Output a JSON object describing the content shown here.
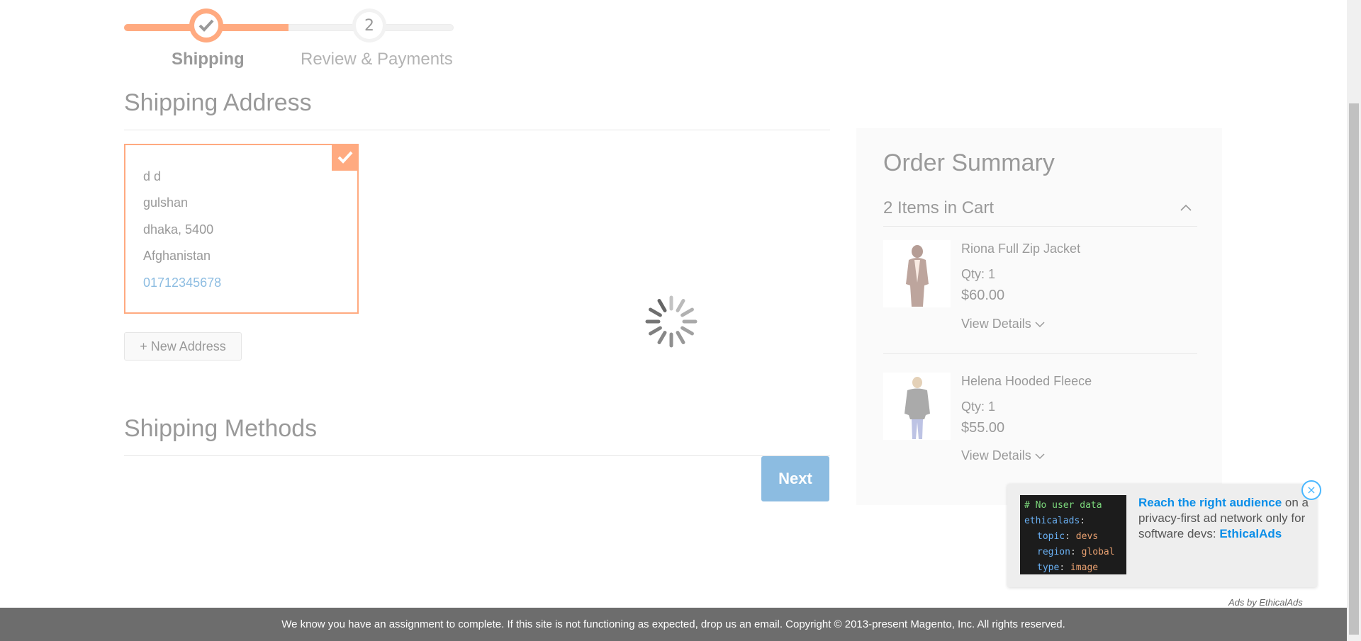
{
  "progress": {
    "steps": [
      {
        "label": "Shipping",
        "state": "complete"
      },
      {
        "label": "Review & Payments",
        "number": "2",
        "state": "pending"
      }
    ]
  },
  "shipping_address": {
    "title": "Shipping Address",
    "selected_address": {
      "name": "d d",
      "street": "gulshan",
      "city_zip": "dhaka, 5400",
      "country": "Afghanistan",
      "phone": "01712345678"
    },
    "new_address_label": "+ New Address"
  },
  "shipping_methods": {
    "title": "Shipping Methods",
    "next_label": "Next"
  },
  "order_summary": {
    "title": "Order Summary",
    "cart_count_label": "2 Items in Cart",
    "items": [
      {
        "name": "Riona Full Zip Jacket",
        "qty": "Qty: 1",
        "price": "$60.00",
        "details": "View Details"
      },
      {
        "name": "Helena Hooded Fleece",
        "qty": "Qty: 1",
        "price": "$55.00",
        "details": "View Details"
      }
    ]
  },
  "ad": {
    "code_lines": [
      {
        "text": "# No user data",
        "color": "#7bd77b"
      },
      {
        "key": "ethicalads",
        "sep": ":"
      },
      {
        "key": "topic",
        "val": "devs"
      },
      {
        "key": "region",
        "val": "global"
      },
      {
        "key": "type",
        "val": "image"
      }
    ],
    "headline": "Reach the right audience",
    "body": "on a privacy-first ad network only for software devs:",
    "brand": "EthicalAds",
    "attribution": "Ads by EthicalAds"
  },
  "footer": {
    "text": "We know you have an assignment to complete. If this site is not functioning as expected, drop us an email. Copyright © 2013-present Magento, Inc. All rights reserved."
  },
  "colors": {
    "accent": "#ff5501",
    "primary": "#1979c3",
    "link": "#1979c3"
  }
}
